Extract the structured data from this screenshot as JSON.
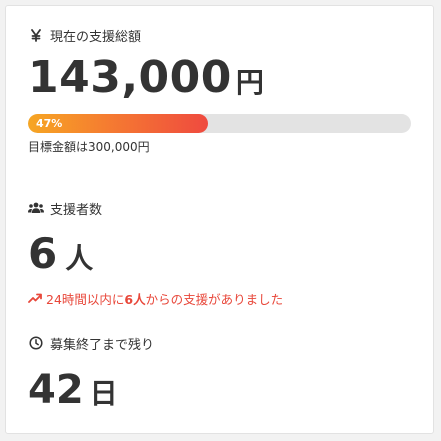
{
  "total_support": {
    "label": "現在の支援総額",
    "amount": "143,000",
    "unit": "円",
    "progress_text": "47%",
    "progress_percent": 47,
    "goal_text": "目標金額は300,000円"
  },
  "supporters": {
    "label": "支援者数",
    "count": "6",
    "unit": "人",
    "recent_prefix": "24時間以内に",
    "recent_count": "6人",
    "recent_suffix": "からの支援がありました"
  },
  "time_left": {
    "label": "募集終了まで残り",
    "days": "42",
    "unit": "日"
  },
  "colors": {
    "progress_start": "#f6a623",
    "progress_end": "#ef4a3f",
    "trend": "#e8473a",
    "text": "#333333"
  },
  "icons": {
    "total_support": "yen-icon",
    "supporters": "users-icon",
    "trend": "trending-up-icon",
    "time_left": "clock-icon"
  }
}
